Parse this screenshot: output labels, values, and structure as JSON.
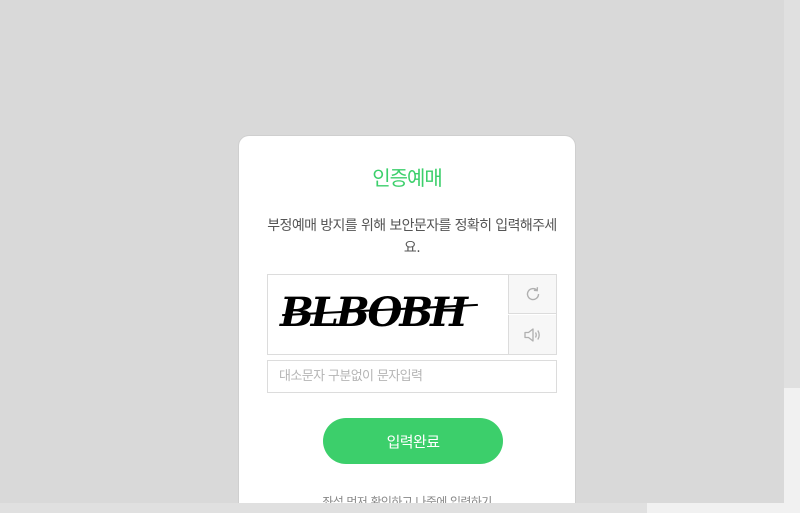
{
  "modal": {
    "title": "인증예매",
    "description": "부정예매 방지를 위해 보안문자를 정확히 입력해주세요.",
    "captcha_text": "BLBOBH",
    "refresh_icon": "refresh-icon",
    "audio_icon": "speaker-icon",
    "input_placeholder": "대소문자 구분없이 문자입력",
    "input_value": "",
    "submit_label": "입력완료",
    "later_link": "좌석 먼저 확인하고 나중에 입력하기"
  },
  "colors": {
    "accent": "#3ccf6b",
    "overlay": "#d9d9d9"
  }
}
